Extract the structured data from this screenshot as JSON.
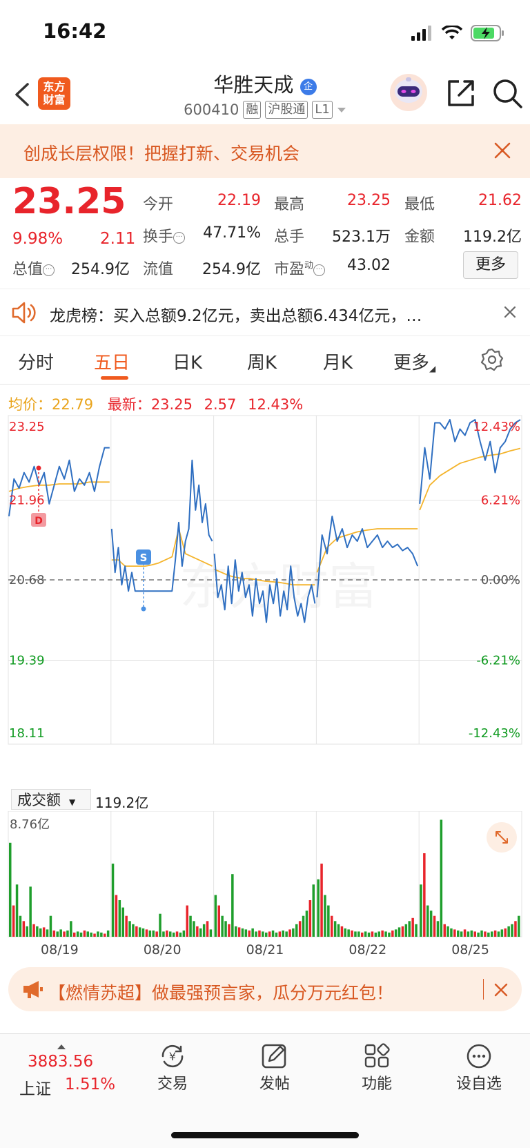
{
  "status": {
    "time": "16:42"
  },
  "header": {
    "logo_text_1": "东方",
    "logo_text_2": "财富",
    "stock_name": "华胜天成",
    "name_badge": "企",
    "code": "600410",
    "tags": [
      "融",
      "沪股通",
      "L1"
    ]
  },
  "banner": {
    "text": "创成长层权限！把握打新、交易机会"
  },
  "quote": {
    "price": "23.25",
    "change_pct": "9.98%",
    "change_amt": "2.11",
    "fields": {
      "open": {
        "label": "今开",
        "value": "22.19"
      },
      "high": {
        "label": "最高",
        "value": "23.25"
      },
      "low": {
        "label": "最低",
        "value": "21.62"
      },
      "turnover": {
        "label": "换手",
        "value": "47.71%"
      },
      "volume": {
        "label": "总手",
        "value": "523.1万"
      },
      "amount": {
        "label": "金额",
        "value": "119.2亿"
      },
      "mktcap": {
        "label": "总值",
        "value": "254.9亿"
      },
      "float_cap": {
        "label": "流值",
        "value": "254.9亿"
      },
      "pe": {
        "label": "市盈",
        "sup": "动",
        "value": "43.02"
      }
    },
    "more_label": "更多"
  },
  "notice": {
    "text": "龙虎榜：买入总额9.2亿元，卖出总额6.434亿元，…"
  },
  "tabs": [
    "分时",
    "五日",
    "日K",
    "周K",
    "月K",
    "更多"
  ],
  "active_tab": "五日",
  "chart_meta": {
    "avg_label": "均价：",
    "avg_value": "22.79",
    "latest_label": "最新：",
    "latest_value": "23.25",
    "latest_change": "2.57",
    "latest_pct": "12.43%"
  },
  "volume_meta": {
    "selector_label": "成交额",
    "total": "119.2亿",
    "ymax_label": "8.76亿"
  },
  "markers": {
    "buy": "S",
    "price_tag": "21.96"
  },
  "chart_data": [
    {
      "type": "line",
      "x_tick_labels": [
        "08/19",
        "08/20",
        "08/21",
        "08/22",
        "08/25"
      ],
      "y_tick_labels": [
        "23.25",
        "21.96",
        "20.68",
        "19.39",
        "18.11"
      ],
      "y2_tick_labels": [
        "12.43%",
        "6.21%",
        "0.00%",
        "-6.21%",
        "-12.43%"
      ],
      "ylim": [
        18.11,
        23.25
      ],
      "reference_price": 20.68,
      "grid": true,
      "series": [
        {
          "name": "最新",
          "color": "#2f6fc1",
          "days": [
            [
              21.7,
              22.3,
              22.15,
              22.4,
              22.25,
              22.5,
              22.2,
              22.4,
              21.9,
              22.2,
              22.5,
              22.3,
              22.6,
              22.1,
              22.3,
              22.2,
              22.4,
              22.1,
              22.5,
              22.8,
              22.8
            ],
            [
              21.5,
              20.8,
              21.2,
              20.6,
              20.9,
              20.5,
              20.8,
              20.5,
              20.5,
              20.5,
              20.5,
              20.5,
              20.5,
              20.5,
              20.5,
              20.5,
              20.5,
              20.5,
              20.5,
              21.0,
              21.6,
              20.9,
              21.3,
              21.5,
              22.6,
              21.8,
              22.2,
              21.6,
              21.9,
              21.4,
              21.3
            ],
            [
              21.1,
              20.4,
              20.6,
              20.2,
              20.9,
              20.3,
              21.0,
              20.5,
              20.8,
              20.4,
              20.6,
              20.1,
              20.7,
              20.3,
              20.5,
              20.0,
              20.6,
              20.3,
              20.7,
              20.1,
              20.5,
              20.2,
              20.9,
              20.4,
              20.1,
              20.3,
              20.0,
              20.4,
              20.6,
              20.3
            ],
            [
              20.4,
              21.4,
              21.1,
              21.7,
              21.3,
              21.5,
              21.2,
              21.4,
              21.3,
              21.5,
              21.2,
              21.3,
              21.4,
              21.2,
              21.3,
              21.2,
              21.25,
              21.15,
              21.2,
              21.1,
              20.9
            ],
            [
              21.9,
              22.8,
              22.3,
              23.2,
              23.2,
              23.1,
              23.25,
              22.9,
              23.1,
              23.0,
              23.2,
              23.25,
              22.9,
              22.6,
              22.9,
              22.4,
              22.8,
              22.9,
              23.1,
              23.2,
              23.25
            ]
          ]
        },
        {
          "name": "均价",
          "color": "#f4b42c",
          "days": [
            [
              22.1,
              22.15,
              22.18,
              22.2,
              22.2,
              22.22,
              22.22,
              22.22,
              22.25,
              22.25,
              22.25
            ],
            [
              21.0,
              21.0,
              20.9,
              20.9,
              20.9,
              20.9,
              20.92,
              20.95,
              21.0,
              21.05,
              21.5,
              21.1,
              21.05,
              21.0,
              20.95,
              20.9
            ],
            [
              20.85,
              20.8,
              20.75,
              20.72,
              20.7,
              20.7,
              20.68,
              20.66,
              20.65,
              20.64,
              20.62,
              20.6,
              20.6,
              20.6,
              20.6
            ],
            [
              20.8,
              21.2,
              21.35,
              21.4,
              21.45,
              21.48,
              21.5,
              21.5,
              21.5,
              21.5,
              21.5
            ],
            [
              21.8,
              22.2,
              22.35,
              22.45,
              22.55,
              22.6,
              22.65,
              22.68,
              22.7,
              22.75,
              22.79
            ]
          ]
        }
      ]
    },
    {
      "type": "bar",
      "title": "成交额",
      "x_tick_labels": [
        "08/19",
        "08/20",
        "08/21",
        "08/22",
        "08/25"
      ],
      "ymax": "8.76亿",
      "series": [
        {
          "name": "成交额",
          "days": [
            [
              9.0,
              3.0,
              5.0,
              2.0,
              1.5,
              1.0,
              4.8,
              1.2,
              1.0,
              0.8,
              0.9,
              0.7,
              2.0,
              0.6,
              0.5,
              0.7,
              0.5,
              0.6,
              1.5,
              0.4,
              0.5,
              0.4,
              0.6,
              0.5,
              0.4,
              0.3,
              0.5,
              0.4,
              0.3,
              0.6
            ],
            [
              7.0,
              4.0,
              3.5,
              2.8,
              2.0,
              1.5,
              1.2,
              1.0,
              0.9,
              0.8,
              0.7,
              0.6,
              0.6,
              0.5,
              2.2,
              0.5,
              0.6,
              0.5,
              0.4,
              0.5,
              0.4,
              0.6,
              3.0,
              2.0,
              1.5,
              1.0,
              0.8,
              1.2,
              1.5,
              0.7
            ],
            [
              4.0,
              3.0,
              2.0,
              1.5,
              1.2,
              6.0,
              1.0,
              0.9,
              0.8,
              0.7,
              0.6,
              0.8,
              0.5,
              0.6,
              0.5,
              0.4,
              0.5,
              0.6,
              0.4,
              0.5,
              0.6,
              0.5,
              0.7,
              0.8,
              1.2,
              1.5,
              2.0,
              2.5,
              3.5,
              5.0
            ],
            [
              5.5,
              7.0,
              4.0,
              3.0,
              2.0,
              1.5,
              1.2,
              1.0,
              0.8,
              0.7,
              0.6,
              0.5,
              0.5,
              0.4,
              0.5,
              0.4,
              0.5,
              0.4,
              0.5,
              0.6,
              0.5,
              0.4,
              0.6,
              0.7,
              0.9,
              1.0,
              1.2,
              1.5,
              1.8,
              1.2
            ],
            [
              5.0,
              8.0,
              3.0,
              2.5,
              2.0,
              1.5,
              11.2,
              1.2,
              1.0,
              0.8,
              0.7,
              0.6,
              0.5,
              0.7,
              0.5,
              0.6,
              0.5,
              0.4,
              0.6,
              0.5,
              0.4,
              0.5,
              0.6,
              0.5,
              0.7,
              0.8,
              1.0,
              1.2,
              1.5,
              2.0
            ]
          ]
        }
      ]
    }
  ],
  "promo": {
    "text": "【燃情苏超】做最强预言家，瓜分万元红包！"
  },
  "bottom_nav": {
    "index_value": "3883.56",
    "index_name": "上证",
    "index_pct": "1.51%",
    "items": [
      "交易",
      "发帖",
      "功能",
      "设自选"
    ]
  },
  "colors": {
    "brand": "#f05a1e",
    "up": "#e8242b",
    "down": "#0e9a1f",
    "price_line": "#2f6fc1",
    "avg_line": "#f4b42c",
    "banner_bg": "#fdeee3"
  }
}
